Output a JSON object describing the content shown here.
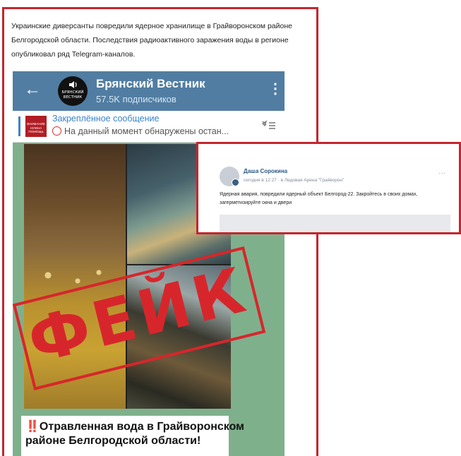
{
  "article": {
    "text": "Украинские диверсанты повредили ядерное хранилище в Грайворонском районе Белгородской области. Последствия радиоактивного заражения воды в регионе опубликовал ряд Telegram-каналов."
  },
  "telegram": {
    "channel_name": "Брянский Вестник",
    "subscribers": "57.5K подписчиков",
    "avatar_text": "БРЯНСКИЙ ВЕСТНИК",
    "pinned_title": "Закреплённое сообщение",
    "pinned_preview": "На данный момент обнаружены остан...",
    "pinned_thumb_text": "ВНИМАНИЕ НУЖНА ПОМОЩЬ",
    "stamp_text": "ФЕЙК",
    "caption_marks": "‼️",
    "caption_text": "Отравленная вода в Грайворонском районе Белгородской области!"
  },
  "vk_post": {
    "author": "Даша Сорокина",
    "meta": "сегодня в 12:27 · в Ледовая Арена \"Грайворон\"",
    "more": "···",
    "text": "Ядерная авария, повредили ядерный объект Белгород-22. Закройтесь в своих домах, загерметизируйте окна и двери"
  },
  "colors": {
    "frame": "#c4262e",
    "tg_header": "#517da2",
    "stamp": "#d7262b"
  },
  "icons": [
    "back-arrow-icon",
    "more-vert-icon",
    "pinned-list-icon",
    "speaker-icon",
    "double-exclamation-icon",
    "more-horiz-icon"
  ]
}
